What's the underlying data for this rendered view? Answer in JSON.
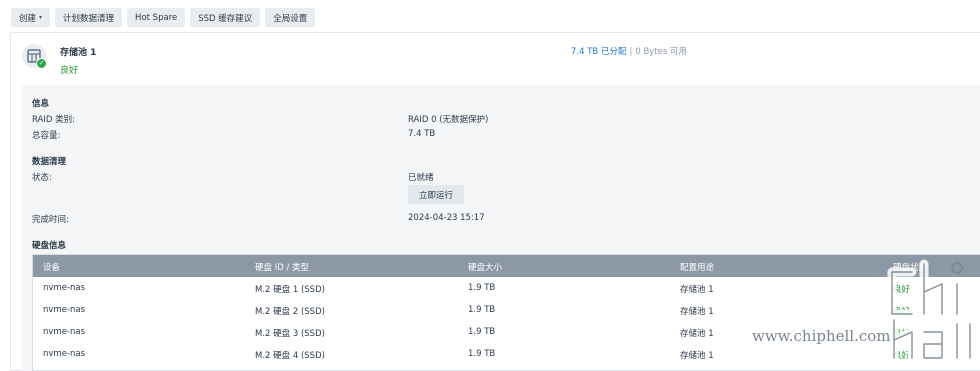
{
  "toolbar": {
    "create_label": "创建",
    "scrub_schedule_label": "计划数据清理",
    "hot_spare_label": "Hot Spare",
    "ssd_cache_label": "SSD 缓存建议",
    "global_settings_label": "全局设置"
  },
  "pool": {
    "name": "存储池 1",
    "status": "良好",
    "allocated": "7.4 TB 已分配",
    "separator": "|",
    "available": "0 Bytes 可用"
  },
  "info": {
    "section_title": "信息",
    "raid_label": "RAID 类别:",
    "raid_value": "RAID 0 (无数据保护)",
    "capacity_label": "总容量:",
    "capacity_value": "7.4 TB"
  },
  "scrub": {
    "section_title": "数据清理",
    "state_label": "状态:",
    "state_value": "已就绪",
    "run_now_label": "立即运行",
    "completed_label": "完成时间:",
    "completed_value": "2024-04-23 15:17"
  },
  "drives": {
    "section_title": "硬盘信息",
    "columns": [
      "设备",
      "硬盘 ID / 类型",
      "硬盘大小",
      "配置用途",
      "硬盘状态"
    ],
    "rows": [
      {
        "device": "nvme-nas",
        "id_type": "M.2 硬盘 1 (SSD)",
        "size": "1.9 TB",
        "usage": "存储池 1",
        "status": "良好"
      },
      {
        "device": "nvme-nas",
        "id_type": "M.2 硬盘 2 (SSD)",
        "size": "1.9 TB",
        "usage": "存储池 1",
        "status": "良好"
      },
      {
        "device": "nvme-nas",
        "id_type": "M.2 硬盘 3 (SSD)",
        "size": "1.9 TB",
        "usage": "存储池 1",
        "status": "良好"
      },
      {
        "device": "nvme-nas",
        "id_type": "M.2 硬盘 4 (SSD)",
        "size": "1.9 TB",
        "usage": "存储池 1",
        "status": "良好"
      }
    ]
  },
  "watermark": {
    "url": "www.chiphell.com",
    "logo_text": "chip hell"
  },
  "colors": {
    "accent": "#1e7ad6",
    "good": "#1f9d2f",
    "table_header": "#8c98a6"
  }
}
